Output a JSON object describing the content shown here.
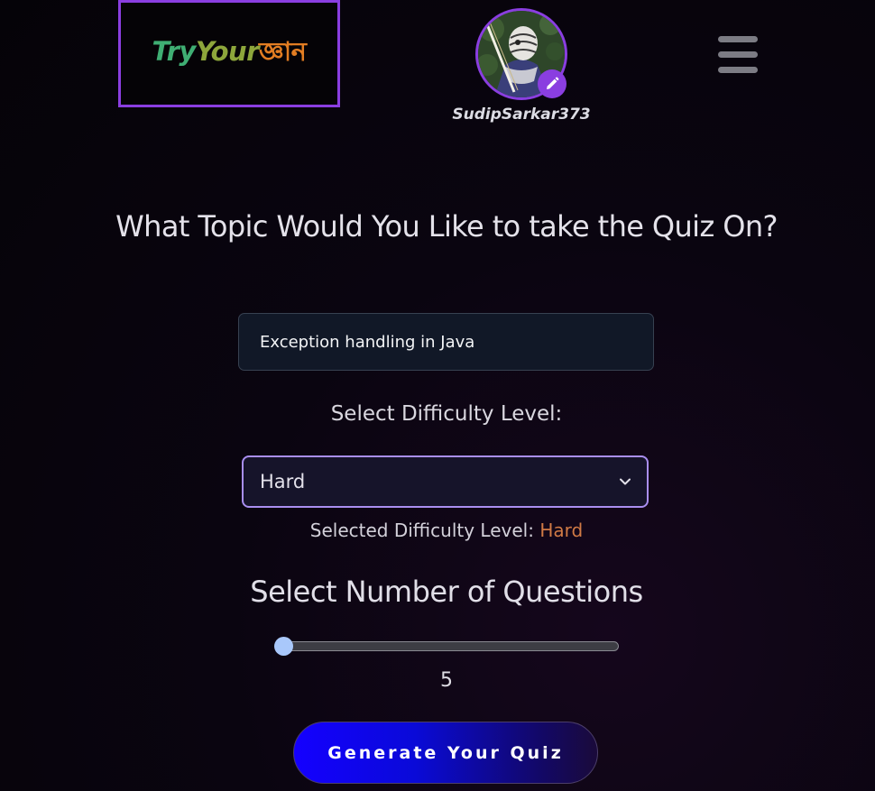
{
  "brand": {
    "logo_part1": "Try",
    "logo_part2": "Your",
    "logo_part3": "জ্ঞান",
    "colors": {
      "part1": "#3fae73",
      "part2": "#8da63b",
      "part3": "#e27d22",
      "accent_border": "#8a3ee0"
    }
  },
  "profile": {
    "username": "SudipSarkar373",
    "avatar_icon": "avatar-image",
    "edit_icon": "pencil-icon"
  },
  "nav": {
    "menu_icon": "hamburger-menu-icon"
  },
  "quiz_form": {
    "heading": "What Topic Would You Like to take the Quiz On?",
    "topic_value": "Exception handling in Java",
    "difficulty_label": "Select Difficulty Level:",
    "difficulty_selected": "Hard",
    "selected_prefix": "Selected Difficulty Level:",
    "selected_value": "Hard",
    "questions_label": "Select Number of Questions",
    "questions_value": "5",
    "questions_min": 5,
    "questions_max": 50,
    "generate_label": "Generate Your Quiz"
  }
}
